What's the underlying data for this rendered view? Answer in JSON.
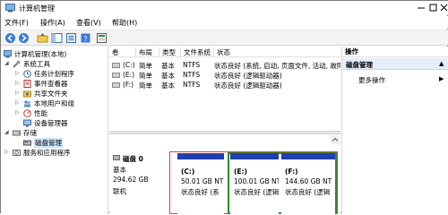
{
  "window": {
    "title": "计算机管理",
    "minimize": "—",
    "maximize": "□",
    "close": "✕"
  },
  "menu": [
    "文件(F)",
    "操作(A)",
    "查看(V)",
    "帮助(H)"
  ],
  "toolbar_icons": [
    "back-icon",
    "forward-icon",
    "up-folder-icon",
    "show-hide-tree-icon",
    "properties-icon",
    "help-icon",
    "export-icon"
  ],
  "tree": {
    "root": "计算机管理(本地)",
    "system_tools": "系统工具",
    "task_scheduler": "任务计划程序",
    "event_viewer": "事件查看器",
    "shared_folders": "共享文件夹",
    "local_users": "本地用户和组",
    "performance": "性能",
    "device_manager": "设备管理器",
    "storage": "存储",
    "disk_management": "磁盘管理",
    "services": "服务和应用程序"
  },
  "list": {
    "headers": [
      "卷",
      "布局",
      "类型",
      "文件系统",
      "状态"
    ],
    "rows": [
      [
        "(C:)",
        "简单",
        "基本",
        "NTFS",
        "状态良好 (系统, 启动, 页面文件, 活动, 故障"
      ],
      [
        "(E:)",
        "简单",
        "基本",
        "NTFS",
        "状态良好 (逻辑驱动器)"
      ],
      [
        "(F:)",
        "简单",
        "基本",
        "NTFS",
        "状态良好 (逻辑驱动器)"
      ]
    ]
  },
  "disk": {
    "name": "磁盘 0",
    "type": "基本",
    "size": "294.62 GB",
    "status": "联机"
  },
  "partitions": [
    {
      "label": "(C:)",
      "size": "50.01 GB NTI",
      "status": "状态良好 (系"
    },
    {
      "label": "(E:)",
      "size": "100.01 GB NT",
      "status": "状态良好 (逻辑"
    },
    {
      "label": "(F:)",
      "size": "144.60 GB NT",
      "status": "状态良好 (逻辑"
    }
  ],
  "actions": {
    "title": "操作",
    "section": "磁盘管理",
    "more": "更多操作"
  },
  "colors": {
    "partition_bar": "#1f3fae",
    "selection_green": "#2e8b2e",
    "highlight_red": "#e04040",
    "tree_selection": "#cde8ff"
  }
}
